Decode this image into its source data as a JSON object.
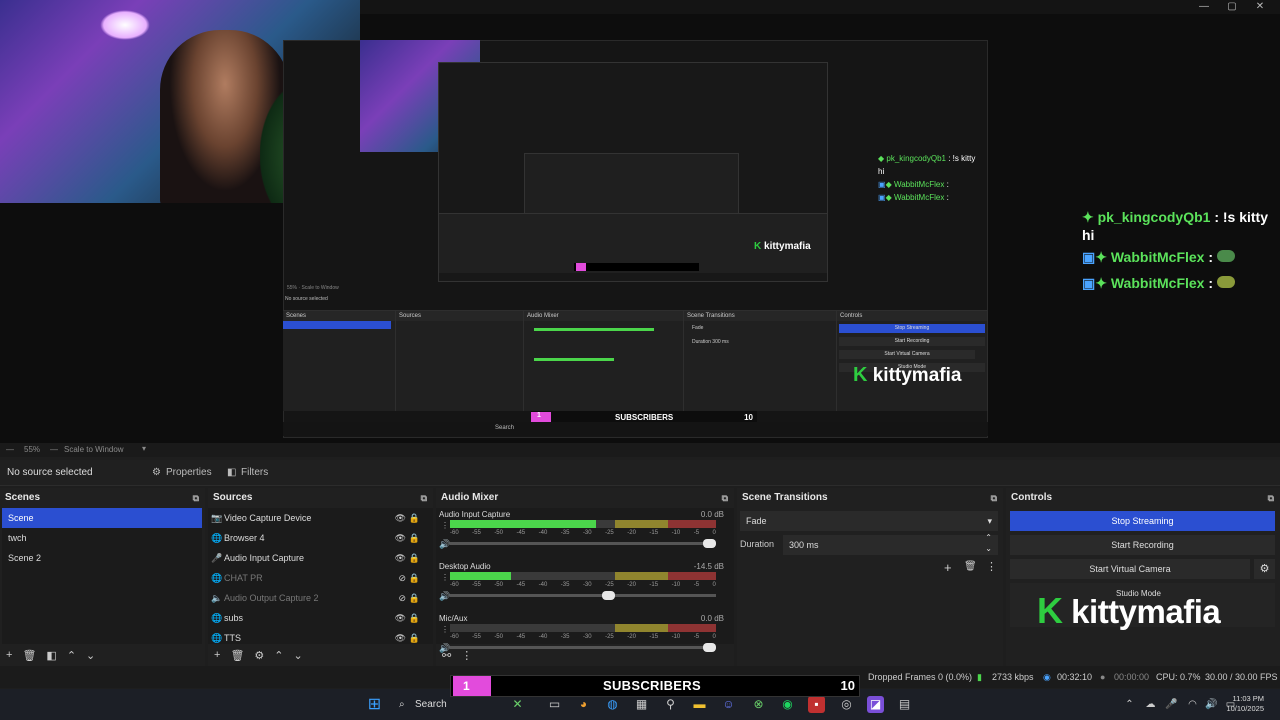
{
  "preview": {
    "nested_chat": [
      {
        "user": "pk_kingcodyQb1",
        "msg": ": !s kitty"
      },
      {
        "cont": "hi"
      },
      {
        "user": "WabbitMcFlex",
        "msg": ":"
      },
      {
        "user": "WabbitMcFlex",
        "msg": ":"
      }
    ],
    "nested_logo": "kittymafia",
    "nested_sub_label": "SUBSCRIBERS",
    "nested_sub_count": "1",
    "nested_sub_goal": "10",
    "nested_zoom": "55%",
    "nested_scale": "Scale to Window",
    "nested_no_source": "No source selected",
    "nested_scenes_title": "Scenes",
    "nested_sources_title": "Sources",
    "nested_mixer_title": "Audio Mixer",
    "nested_transitions_title": "Scene Transitions",
    "nested_controls_title": "Controls",
    "nested_stop": "Stop Streaming",
    "nested_start_rec": "Start Recording",
    "nested_virtual_cam": "Start Virtual Camera",
    "nested_studio": "Studio Mode",
    "nested_fade": "Fade",
    "nested_duration": "Duration",
    "nested_duration_val": "300 ms",
    "nested_search": "Search"
  },
  "chat": {
    "line1_user": "pk_kingcodyQb1",
    "line1_msg": ": !s kitty",
    "line1_cont": "hi",
    "line2_user": "WabbitMcFlex",
    "line2_msg": ":",
    "line3_user": "WabbitMcFlex",
    "line3_msg": ":"
  },
  "zoom_row": {
    "zoom": "55%",
    "scale": "Scale to Window"
  },
  "source_bar": {
    "no_source": "No source selected",
    "properties": "Properties",
    "filters": "Filters"
  },
  "scenes": {
    "title": "Scenes",
    "items": [
      "Scene",
      "twch",
      "Scene 2"
    ]
  },
  "sources": {
    "title": "Sources",
    "items": [
      {
        "label": "Video Capture Device",
        "icon": "camera-icon",
        "visible": true
      },
      {
        "label": "Browser 4",
        "icon": "globe-icon",
        "visible": true
      },
      {
        "label": "Audio Input Capture",
        "icon": "mic-icon",
        "visible": true
      },
      {
        "label": "CHAT PR",
        "icon": "globe-icon",
        "visible": false
      },
      {
        "label": "Audio Output Capture 2",
        "icon": "speaker-icon",
        "visible": false
      },
      {
        "label": "subs",
        "icon": "globe-icon",
        "visible": true
      },
      {
        "label": "TTS",
        "icon": "globe-icon",
        "visible": true
      }
    ]
  },
  "mixer": {
    "title": "Audio Mixer",
    "ticks": [
      "-60",
      "-55",
      "-50",
      "-45",
      "-40",
      "-35",
      "-30",
      "-25",
      "-20",
      "-15",
      "-10",
      "-5",
      "0"
    ],
    "channels": [
      {
        "name": "Audio Input Capture",
        "db": "0.0 dB",
        "level": 0.55,
        "volume": 1.0
      },
      {
        "name": "Desktop Audio",
        "db": "-14.5 dB",
        "level": 0.23,
        "volume": 0.6
      },
      {
        "name": "Mic/Aux",
        "db": "0.0 dB",
        "level": 0.0,
        "volume": 1.0
      }
    ]
  },
  "transitions": {
    "title": "Scene Transitions",
    "type": "Fade",
    "duration_label": "Duration",
    "duration_value": "300 ms"
  },
  "controls": {
    "title": "Controls",
    "stop_streaming": "Stop Streaming",
    "start_recording": "Start Recording",
    "start_virtual_camera": "Start Virtual Camera",
    "studio_mode": "Studio Mode"
  },
  "logo": {
    "k": "K",
    "text": "kittymafia"
  },
  "status": {
    "dropped": "Dropped Frames 0 (0.0%)",
    "bitrate": "2733 kbps",
    "live_time": "00:32:10",
    "rec_time": "00:00:00",
    "cpu": "CPU: 0.7%",
    "fps": "30.00 / 30.00 FPS"
  },
  "sub_bar": {
    "count": "1",
    "label": "SUBSCRIBERS",
    "goal": "10"
  },
  "taskbar": {
    "search": "Search",
    "time": "11:03 PM",
    "date": "10/10/2025"
  },
  "colors": {
    "accent": "#2b4fd1",
    "logo_green": "#2ecc40",
    "sub_pink": "#e24bdc",
    "meter_green": "#4bd64b"
  }
}
